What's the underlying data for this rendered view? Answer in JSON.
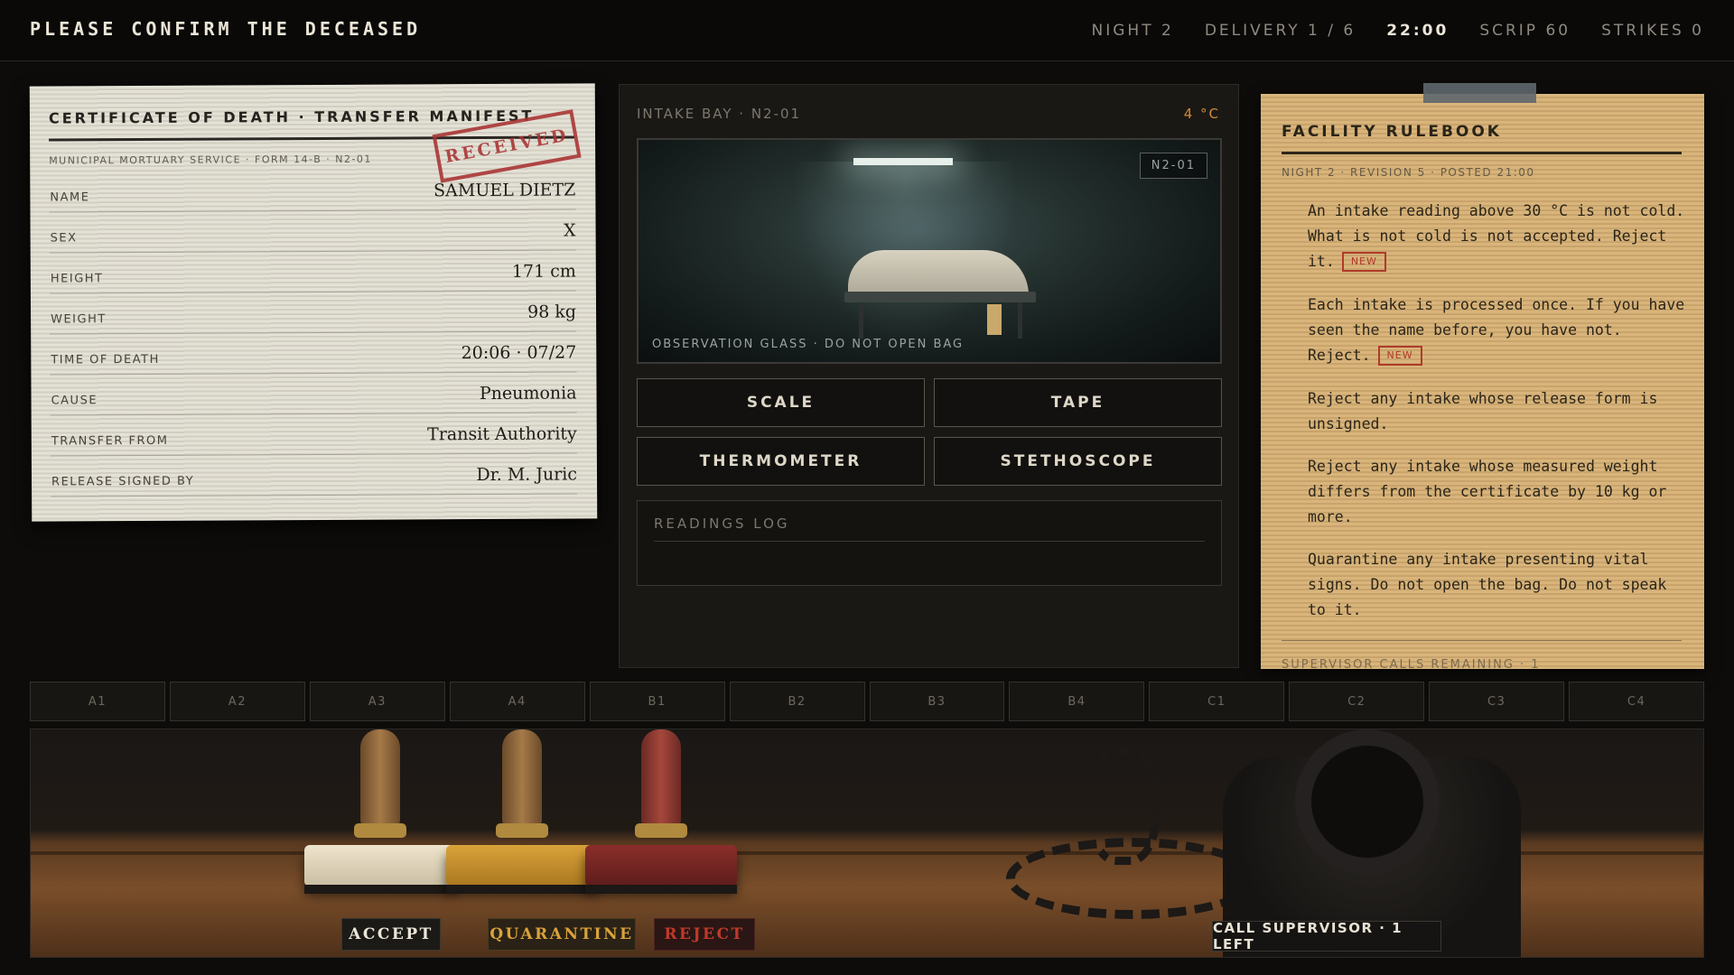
{
  "topbar": {
    "title": "PLEASE CONFIRM THE DECEASED",
    "night": "NIGHT 2",
    "delivery": "DELIVERY 1 / 6",
    "clock": "22:00",
    "scrip": "SCRIP 60",
    "strikes": "STRIKES 0"
  },
  "certificate": {
    "title": "CERTIFICATE OF DEATH · TRANSFER MANIFEST",
    "subtitle": "MUNICIPAL MORTUARY SERVICE · FORM 14-B · N2-01",
    "stamp": "RECEIVED",
    "fields": [
      {
        "label": "NAME",
        "value": "SAMUEL DIETZ"
      },
      {
        "label": "SEX",
        "value": "X"
      },
      {
        "label": "HEIGHT",
        "value": "171 cm"
      },
      {
        "label": "WEIGHT",
        "value": "98 kg"
      },
      {
        "label": "TIME OF DEATH",
        "value": "20:06 · 07/27"
      },
      {
        "label": "CAUSE",
        "value": "Pneumonia"
      },
      {
        "label": "TRANSFER FROM",
        "value": "Transit Authority"
      },
      {
        "label": "RELEASE SIGNED BY",
        "value": "Dr. M. Juric"
      }
    ]
  },
  "intake": {
    "label": "INTAKE BAY · N2-01",
    "temperature": "4 °C",
    "viewport_caption": "OBSERVATION GLASS · DO NOT OPEN BAG",
    "viewport_tag": "N2-01",
    "tools": [
      "SCALE",
      "TAPE",
      "THERMOMETER",
      "STETHOSCOPE"
    ],
    "readings_title": "READINGS LOG"
  },
  "rulebook": {
    "title": "FACILITY RULEBOOK",
    "subtitle": "NIGHT 2 · REVISION 5 · POSTED 21:00",
    "new_label": "NEW",
    "rules": [
      "An intake reading above 30 °C is not cold. What is not cold is not accepted. Reject it.",
      "Each intake is processed once. If you have seen the name before, you have not. Reject.",
      "Reject any intake whose release form is unsigned.",
      "Reject any intake whose measured weight differs from the certificate by 10 kg or more.",
      "Quarantine any intake presenting vital signs. Do not open the bag. Do not speak to it."
    ],
    "footer": "SUPERVISOR CALLS REMAINING · 1"
  },
  "slots": [
    "A1",
    "A2",
    "A3",
    "A4",
    "B1",
    "B2",
    "B3",
    "B4",
    "C1",
    "C2",
    "C3",
    "C4"
  ],
  "desk": {
    "accept": "ACCEPT",
    "quarantine": "QUARANTINE",
    "reject": "REJECT",
    "call": "CALL SUPERVISOR · 1 LEFT"
  },
  "colors": {
    "accept": "#e8e2d4",
    "quarantine": "#d9a23a",
    "reject": "#c0392b",
    "temperature": "#d08a3a"
  }
}
